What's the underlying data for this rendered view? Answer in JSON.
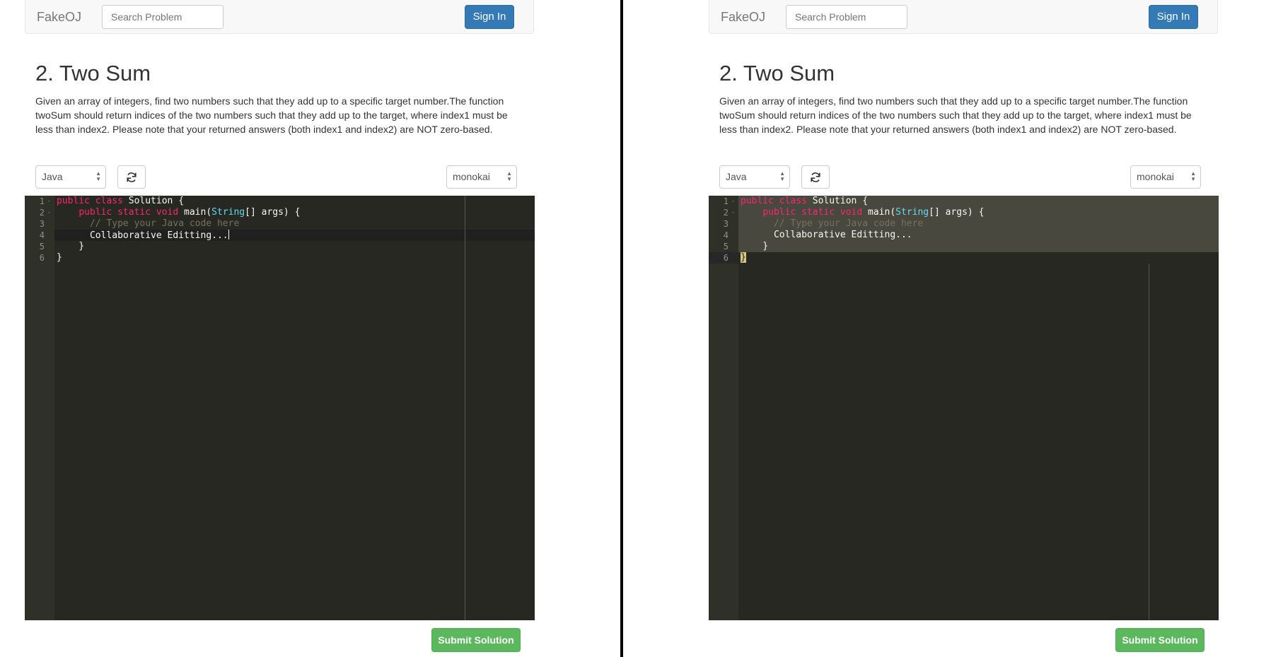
{
  "navbar": {
    "brand": "FakeOJ",
    "search_placeholder": "Search Problem",
    "signin_label": "Sign In"
  },
  "problem": {
    "title": "2. Two Sum",
    "description": "Given an array of integers, find two numbers such that they add up to a specific target number.The function twoSum should return indices of the two numbers such that they add up to the target, where index1 must be less than index2. Please note that your returned answers (both index1 and index2) are NOT zero-based."
  },
  "toolbar": {
    "language": "Java",
    "theme": "monokai",
    "reset_icon": "refresh-icon"
  },
  "editor": {
    "line_numbers": [
      "1",
      "2",
      "3",
      "4",
      "5",
      "6"
    ],
    "fold_markers": [
      "-",
      "-"
    ],
    "tokens": {
      "l1_kw": "public class",
      "l1_rest": " Solution {",
      "l2_indent": "    ",
      "l2_kw": "public static void",
      "l2_mid": " main(",
      "l2_type": "String",
      "l2_rest": "[] args) {",
      "l3_indent": "      ",
      "l3_comment": "// Type your Java code here",
      "l4": "      Collaborative Editting...",
      "l5": "    }",
      "l6": "}"
    }
  },
  "submit_label": "Submit Solution",
  "colors": {
    "primary": "#337ab7",
    "success": "#5cb85c",
    "editor_bg": "#272822",
    "keyword": "#f92672",
    "type": "#66d9ef",
    "comment": "#75715e"
  }
}
